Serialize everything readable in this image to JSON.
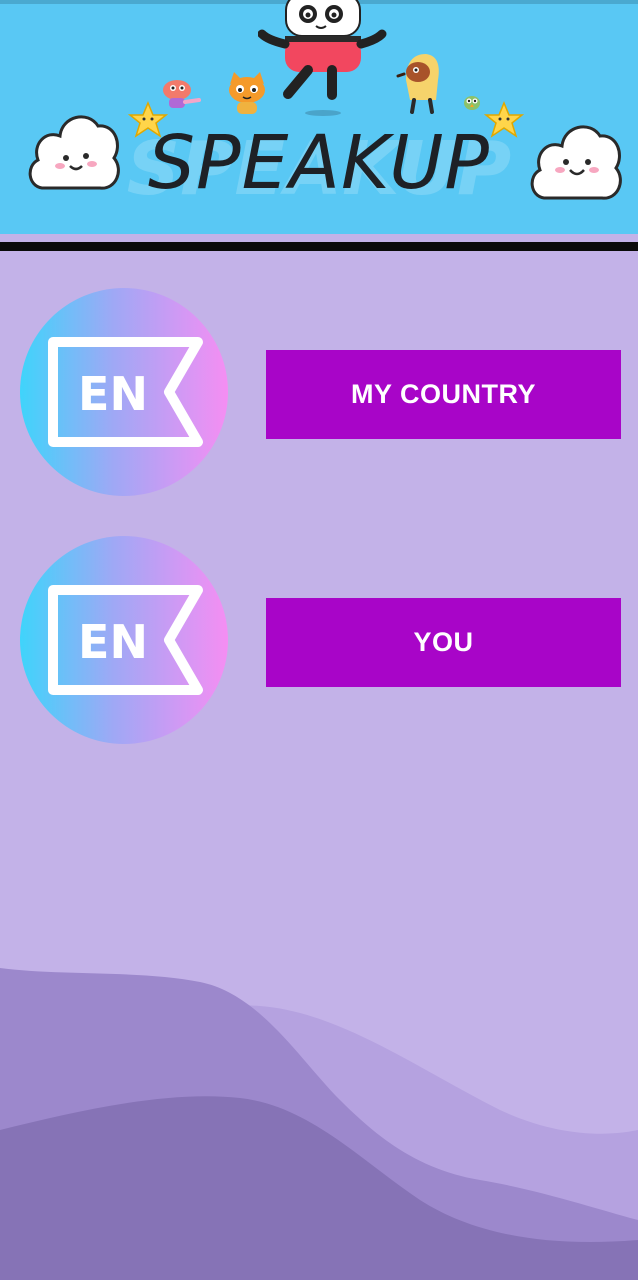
{
  "header": {
    "title": "SPEAKUP",
    "background_color": "#59c8f4",
    "decorations": [
      "cloud-icon",
      "star-icon",
      "panda-character",
      "cat-character",
      "bird-character"
    ]
  },
  "lessons": [
    {
      "icon_text": "EN",
      "label": "MY COUNTRY"
    },
    {
      "icon_text": "EN",
      "label": "YOU"
    }
  ],
  "colors": {
    "background": "#c3b2e8",
    "button": "#a805c8",
    "button_text": "#ffffff",
    "wave_light": "#b5a2e0",
    "wave_mid": "#9c88cc",
    "wave_dark": "#8673b6"
  }
}
